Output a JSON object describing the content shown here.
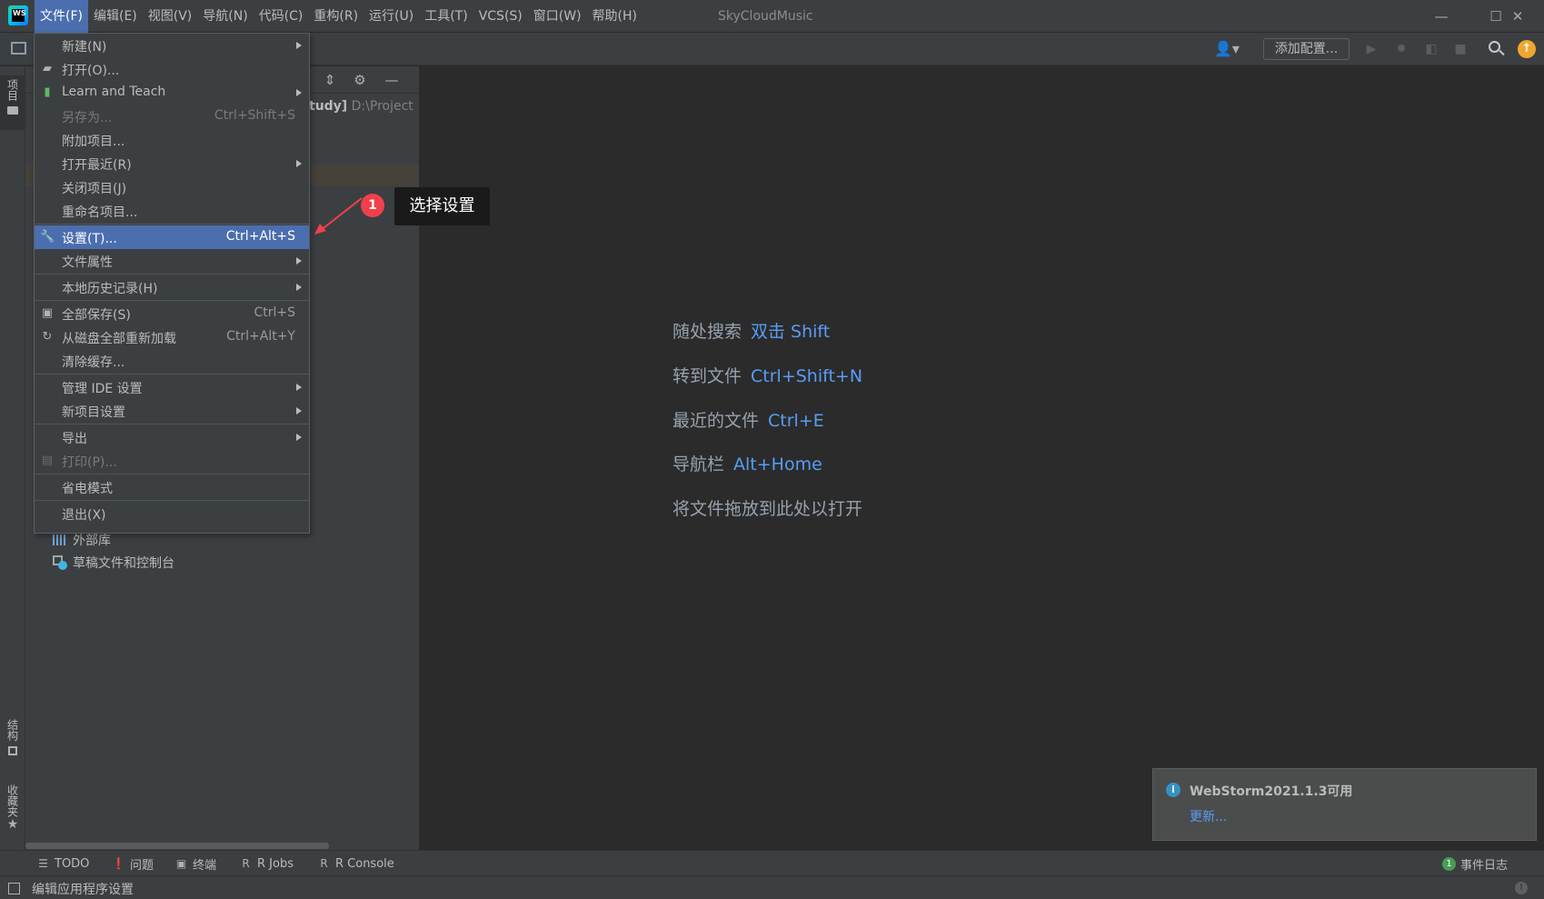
{
  "titlebar": {
    "logo_text": "WS",
    "menu": [
      "文件(F)",
      "编辑(E)",
      "视图(V)",
      "导航(N)",
      "代码(C)",
      "重构(R)",
      "运行(U)",
      "工具(T)",
      "VCS(S)",
      "窗口(W)",
      "帮助(H)"
    ],
    "project_name": "SkyCloudMusic",
    "controls": {
      "minimize": "—",
      "maximize": "☐",
      "close": "✕"
    }
  },
  "toolbar": {
    "user_icon": "👤▾",
    "config_label": "添加配置...",
    "run_icon": "▶",
    "debug_icon": "✹",
    "coverage_icon": "◧",
    "stop_icon": "■",
    "update_icon": "↑"
  },
  "left_stripe": {
    "project_tab": "项目",
    "structure_tab": "结构",
    "favorites_tab": "收藏夹"
  },
  "project_panel": {
    "header_icons": {
      "collapse": "⇕",
      "settings": "⚙",
      "hide": "—"
    },
    "root_name_fragment": "tudy]",
    "root_path_fragment": "D:\\Project",
    "external_libraries": "外部库",
    "scratches": "草稿文件和控制台"
  },
  "editor_hints": [
    {
      "label": "随处搜索",
      "key": "双击 Shift"
    },
    {
      "label": "转到文件",
      "key": "Ctrl+Shift+N"
    },
    {
      "label": "最近的文件",
      "key": "Ctrl+E"
    },
    {
      "label": "导航栏",
      "key": "Alt+Home"
    },
    {
      "label": "将文件拖放到此处以打开",
      "key": ""
    }
  ],
  "file_menu": {
    "items": [
      {
        "label": "新建(N)",
        "shortcut": "",
        "submenu": true
      },
      {
        "label": "打开(O)...",
        "shortcut": "",
        "icon": "folder-icon"
      },
      {
        "label": "Learn and Teach",
        "shortcut": "",
        "submenu": true,
        "icon": "book-icon"
      },
      {
        "label": "另存为...",
        "shortcut": "Ctrl+Shift+S",
        "disabled": true
      },
      {
        "label": "附加项目...",
        "shortcut": ""
      },
      {
        "label": "打开最近(R)",
        "shortcut": "",
        "submenu": true
      },
      {
        "label": "关闭项目(J)",
        "shortcut": ""
      },
      {
        "label": "重命名项目...",
        "shortcut": ""
      },
      {
        "label": "设置(T)...",
        "shortcut": "Ctrl+Alt+S",
        "selected": true,
        "icon": "wrench-icon"
      },
      {
        "label": "文件属性",
        "shortcut": "",
        "submenu": true
      },
      {
        "label": "本地历史记录(H)",
        "shortcut": "",
        "submenu": true
      },
      {
        "label": "全部保存(S)",
        "shortcut": "Ctrl+S",
        "icon": "save-icon"
      },
      {
        "label": "从磁盘全部重新加载",
        "shortcut": "Ctrl+Alt+Y",
        "icon": "reload-icon"
      },
      {
        "label": "清除缓存...",
        "shortcut": ""
      },
      {
        "label": "管理 IDE 设置",
        "shortcut": "",
        "submenu": true
      },
      {
        "label": "新项目设置",
        "shortcut": "",
        "submenu": true
      },
      {
        "label": "导出",
        "shortcut": "",
        "submenu": true
      },
      {
        "label": "打印(P)...",
        "shortcut": "",
        "disabled": true,
        "icon": "print-icon"
      },
      {
        "label": "省电模式",
        "shortcut": ""
      },
      {
        "label": "退出(X)",
        "shortcut": ""
      }
    ]
  },
  "callout": {
    "number": "1",
    "text": "选择设置"
  },
  "bottom_bar": {
    "todo": "TODO",
    "problems": "问题",
    "terminal": "终端",
    "rjobs": "R Jobs",
    "rconsole": "R Console",
    "event_count": "1",
    "event_log": "事件日志"
  },
  "status_bar": {
    "text": "编辑应用程序设置"
  },
  "notification": {
    "title": "WebStorm2021.1.3可用",
    "link": "更新..."
  },
  "colors": {
    "accent": "#4b6eaf",
    "link": "#589df6",
    "callout_red": "#f1404b",
    "update_orange": "#f0a732"
  }
}
